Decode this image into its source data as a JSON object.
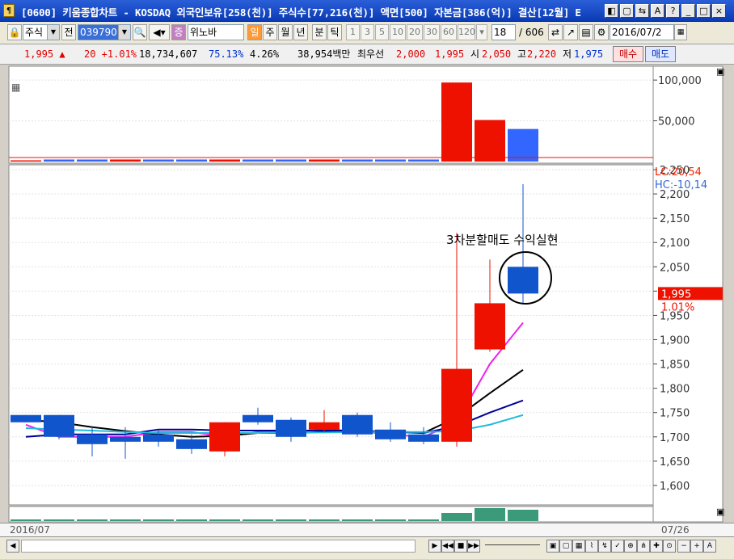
{
  "window": {
    "title": "[0600] 키움종합차트 - KOSDAQ 외국인보유[258(천)] 주식수[77,216(천)] 액면[500] 자본금[386(억)] 결산[12월] E",
    "buttons": [
      "◧",
      "▢",
      "⇆",
      "A",
      "?",
      "_",
      "□",
      "×"
    ]
  },
  "toolbar": {
    "market": "주식",
    "prev_label": "전",
    "code": "039790",
    "sign_label": "증",
    "name": "위노바",
    "period_day": "일",
    "period_week": "주",
    "period_month": "월",
    "period_year": "년",
    "period_min": "분",
    "period_tick": "틱",
    "intervals": [
      "1",
      "3",
      "5",
      "10",
      "20",
      "30",
      "60",
      "120"
    ],
    "count": "18",
    "total": "/ 606",
    "date": "2016/07/2"
  },
  "quote": {
    "price": "1,995 ▲",
    "change": "20 +1.01%",
    "volume": "18,734,607",
    "ratio": "75.13%",
    "turnover": "4.26%",
    "amount": "38,954백만",
    "pref_label": "최우선",
    "ask": "2,000",
    "bid": "1,995",
    "open_label": "시",
    "open": "2,050",
    "high_label": "고",
    "high": "2,220",
    "low_label": "저",
    "low": "1,975",
    "buy_label": "매수",
    "sell_label": "매도"
  },
  "colors": {
    "up": "#ee1100",
    "down": "#1155cc",
    "ma5": "#ee22ee",
    "ma10": "#000000",
    "ma20": "#000099",
    "ma60": "#22bbdd",
    "volume_bar": "#3a9a7a"
  },
  "chart_data": {
    "type": "candlestick",
    "x": [
      "1",
      "2",
      "3",
      "4",
      "5",
      "6",
      "7",
      "8",
      "9",
      "10",
      "11",
      "12",
      "13",
      "14",
      "15",
      "16"
    ],
    "ohlc": [
      [
        1745,
        1745,
        1730,
        1730
      ],
      [
        1745,
        1745,
        1695,
        1700
      ],
      [
        1705,
        1720,
        1660,
        1685
      ],
      [
        1700,
        1720,
        1655,
        1690
      ],
      [
        1705,
        1715,
        1680,
        1690
      ],
      [
        1695,
        1705,
        1665,
        1675
      ],
      [
        1670,
        1730,
        1660,
        1730
      ],
      [
        1745,
        1760,
        1725,
        1730
      ],
      [
        1735,
        1740,
        1690,
        1700
      ],
      [
        1715,
        1755,
        1710,
        1730
      ],
      [
        1745,
        1750,
        1700,
        1705
      ],
      [
        1715,
        1730,
        1690,
        1695
      ],
      [
        1705,
        1720,
        1685,
        1690
      ],
      [
        1690,
        2120,
        1680,
        1840
      ],
      [
        1880,
        2065,
        1875,
        1975
      ],
      [
        2050,
        2220,
        1975,
        1995
      ]
    ],
    "ma": [
      {
        "values": [
          1725,
          1700,
          1700,
          1700,
          1710,
          1710,
          1700,
          1710,
          1710,
          1715,
          1712,
          1705,
          1700,
          1730,
          1850,
          1935
        ]
      },
      {
        "values": [
          1735,
          1730,
          1720,
          1712,
          1705,
          1700,
          1702,
          1708,
          1708,
          1710,
          1711,
          1712,
          1708,
          1740,
          1790,
          1838
        ]
      },
      {
        "values": [
          1700,
          1705,
          1705,
          1705,
          1715,
          1715,
          1713,
          1713,
          1713,
          1713,
          1713,
          1710,
          1708,
          1722,
          1750,
          1775
        ]
      },
      {
        "values": [
          1718,
          1715,
          1713,
          1710,
          1708,
          1708,
          1708,
          1708,
          1709,
          1709,
          1710,
          1710,
          1710,
          1712,
          1725,
          1745
        ]
      }
    ],
    "trading_volume": [
      1.5,
      2.5,
      2.5,
      2.5,
      2.5,
      2.5,
      2.5,
      2.5,
      2.5,
      2.5,
      2.5,
      2.5,
      2.5,
      97,
      51,
      40
    ],
    "trading_volume_up": [
      true,
      false,
      false,
      true,
      false,
      false,
      true,
      false,
      false,
      true,
      false,
      false,
      false,
      true,
      true,
      false
    ],
    "volume_ticks": [
      "100,000",
      "50,000"
    ],
    "price_ticks": [
      "2,250",
      "2,200",
      "2,150",
      "2,100",
      "2,050",
      "2,000",
      "1,950",
      "1,900",
      "1,850",
      "1,800",
      "1,750",
      "1,700",
      "1,650",
      "1,600"
    ],
    "price_ylim": [
      1560,
      2260
    ],
    "lc_label": "LC:20,54",
    "hc_label": "HC:-10,14",
    "current_price_label": "1,995",
    "current_change_label": "1.01%",
    "annotation": "3차분할매도 수익실현",
    "bottom_indicator": [
      0.2,
      0.2,
      0.2,
      0.2,
      0.2,
      0.2,
      0.2,
      0.2,
      0.2,
      0.2,
      0.2,
      0.2,
      0.2,
      1.0,
      1.6,
      1.4
    ],
    "x_start_label": "2016/07",
    "x_end_label": "07/26"
  }
}
